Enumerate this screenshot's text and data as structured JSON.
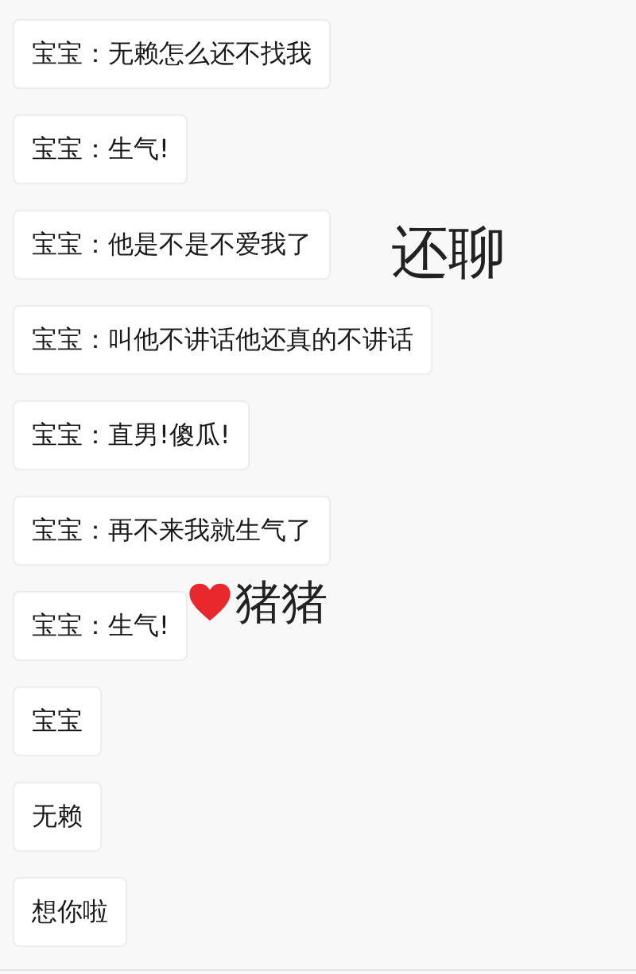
{
  "background_texts": [
    {
      "text": "还聊"
    },
    {
      "text": "猪猪"
    }
  ],
  "messages": [
    {
      "text": "宝宝：无赖怎么还不找我"
    },
    {
      "text": "宝宝：生气!"
    },
    {
      "text": "宝宝：他是不是不爱我了"
    },
    {
      "text": "宝宝：叫他不讲话他还真的不讲话"
    },
    {
      "text": "宝宝：直男!傻瓜!"
    },
    {
      "text": "宝宝：再不来我就生气了"
    },
    {
      "text": "宝宝：生气!"
    },
    {
      "text": "宝宝"
    },
    {
      "text": "无赖"
    },
    {
      "text": "想你啦"
    }
  ]
}
